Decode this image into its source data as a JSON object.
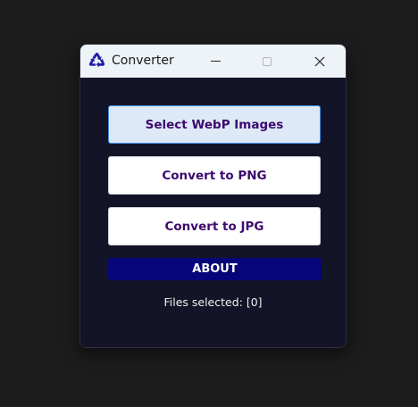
{
  "window": {
    "title": "Converter",
    "app_icon": "recycle-icon",
    "controls": {
      "minimize": "minimize-icon",
      "maximize": "maximize-icon",
      "close": "close-icon"
    }
  },
  "buttons": {
    "select_label": "Select WebP Images",
    "png_label": "Convert to PNG",
    "jpg_label": "Convert to JPG",
    "about_label": "ABOUT"
  },
  "status": {
    "text": "Files selected: [0]"
  },
  "colors": {
    "content_background": "#141428",
    "button_text": "#3d0a6e",
    "selected_button_background": "#dde9f7",
    "selected_button_border": "#3b8be0",
    "about_background": "#06067a",
    "titlebar_background": "#eef3f8"
  }
}
